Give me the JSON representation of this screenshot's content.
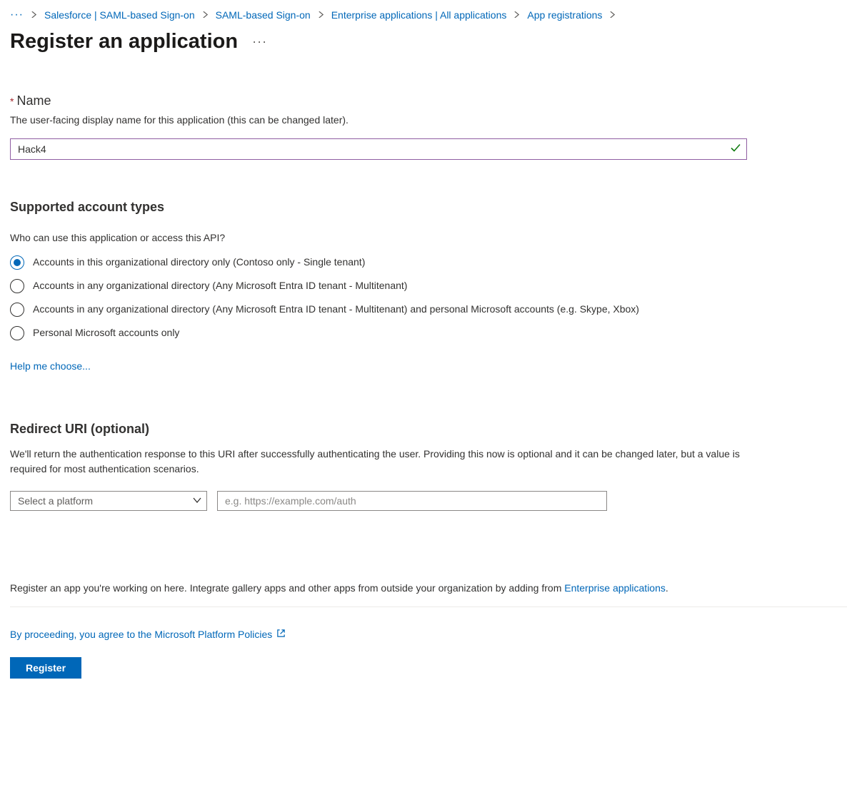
{
  "breadcrumb": {
    "items": [
      "Salesforce | SAML-based Sign-on",
      "SAML-based Sign-on",
      "Enterprise applications | All applications",
      "App registrations"
    ]
  },
  "page": {
    "title": "Register an application"
  },
  "name_section": {
    "label": "Name",
    "description": "The user-facing display name for this application (this can be changed later).",
    "value": "Hack4"
  },
  "account_types": {
    "title": "Supported account types",
    "question": "Who can use this application or access this API?",
    "options": [
      "Accounts in this organizational directory only (Contoso only - Single tenant)",
      "Accounts in any organizational directory (Any Microsoft Entra ID tenant - Multitenant)",
      "Accounts in any organizational directory (Any Microsoft Entra ID tenant - Multitenant) and personal Microsoft accounts (e.g. Skype, Xbox)",
      "Personal Microsoft accounts only"
    ],
    "help_link": "Help me choose..."
  },
  "redirect": {
    "title": "Redirect URI (optional)",
    "description": "We'll return the authentication response to this URI after successfully authenticating the user. Providing this now is optional and it can be changed later, but a value is required for most authentication scenarios.",
    "platform_placeholder": "Select a platform",
    "uri_placeholder": "e.g. https://example.com/auth"
  },
  "footer": {
    "note_prefix": "Register an app you're working on here. Integrate gallery apps and other apps from outside your organization by adding from ",
    "note_link": "Enterprise applications",
    "note_suffix": ".",
    "policy_text": "By proceeding, you agree to the Microsoft Platform Policies",
    "register_label": "Register"
  }
}
